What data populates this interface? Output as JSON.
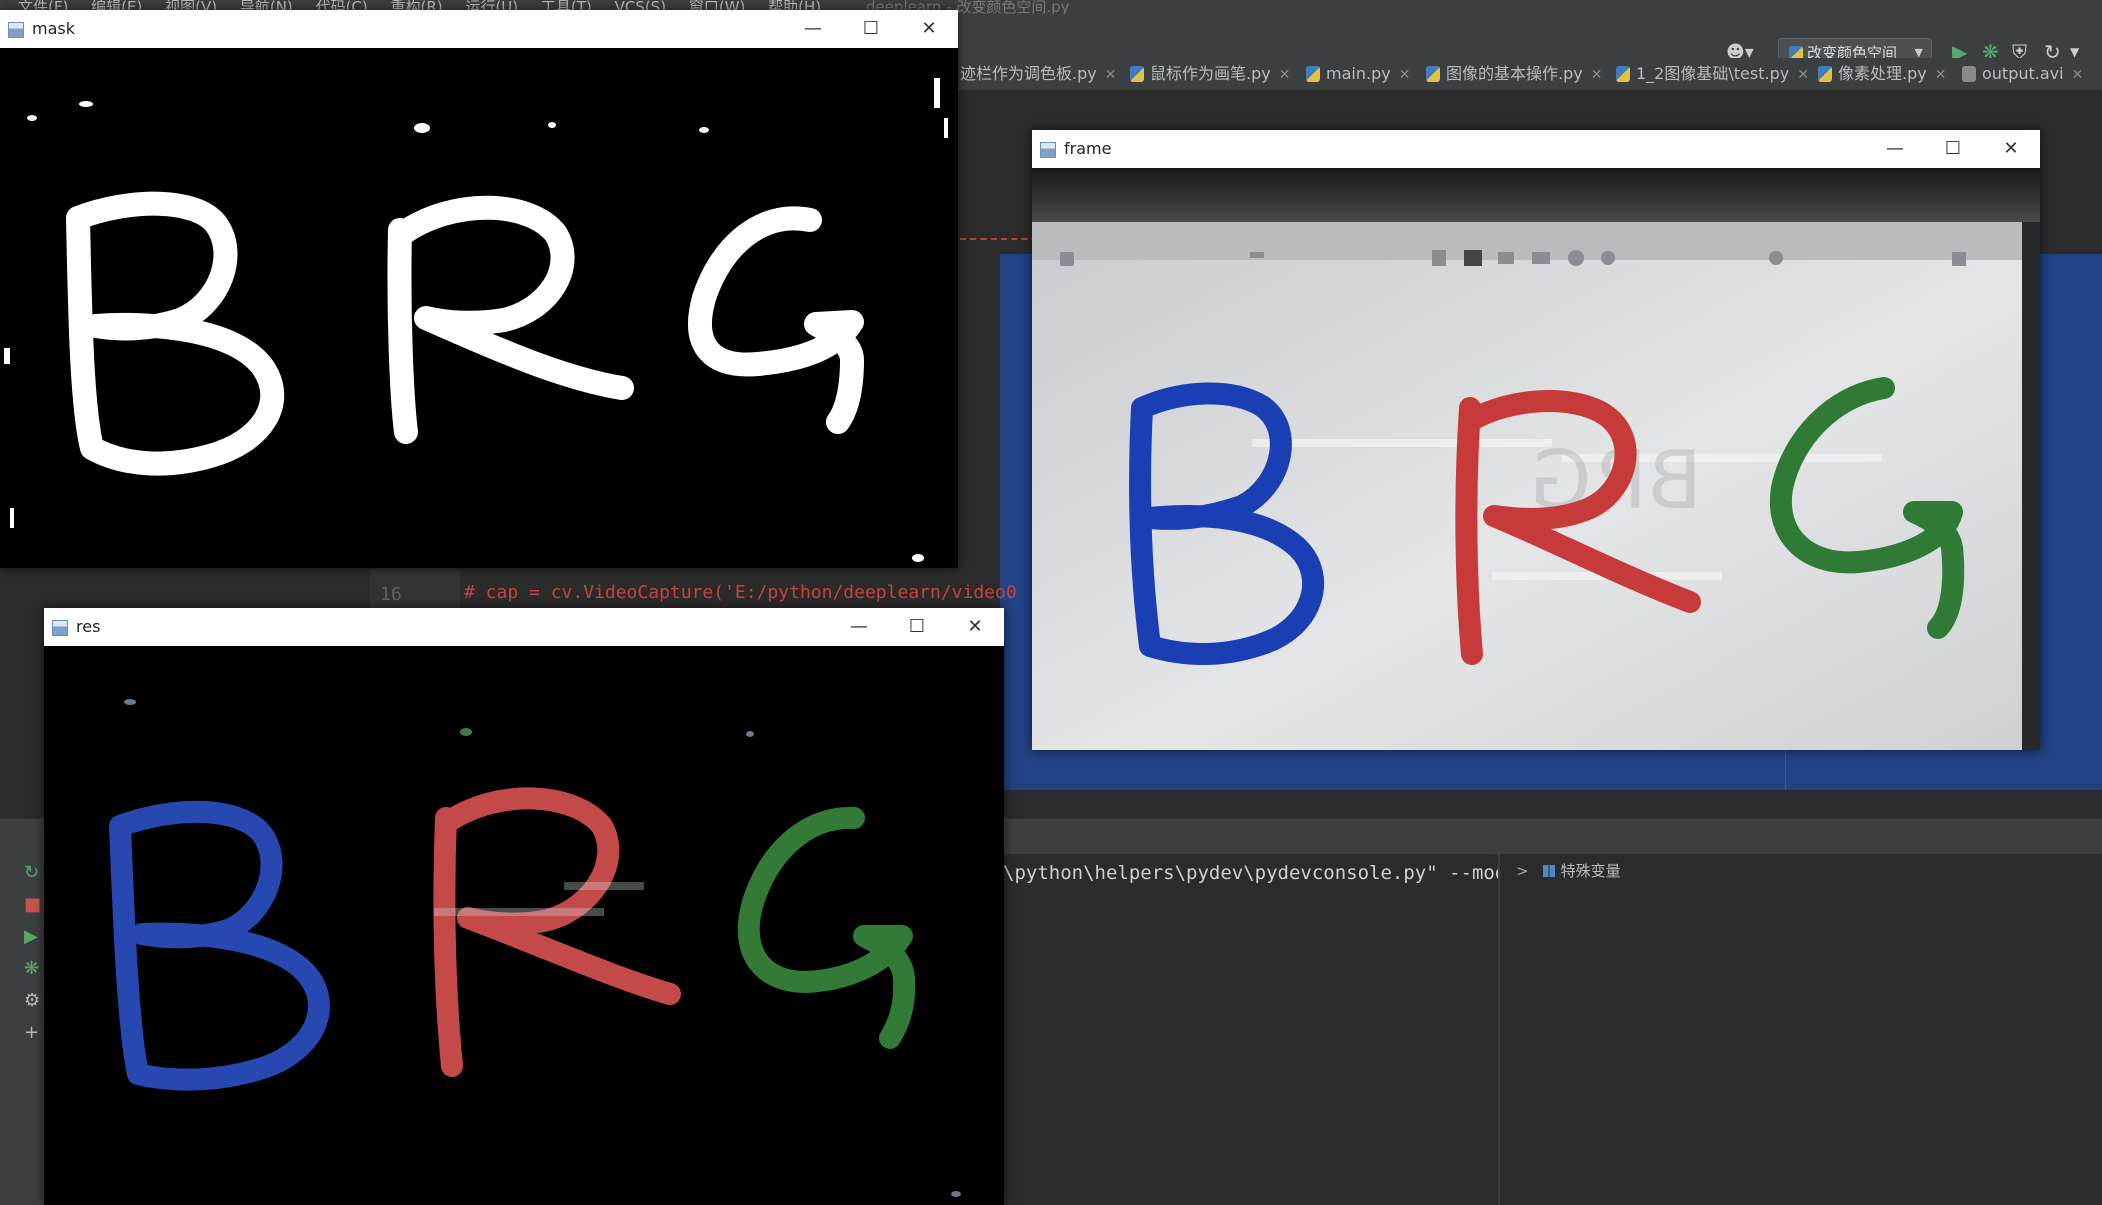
{
  "ide": {
    "menu": [
      "文件(F)",
      "编辑(E)",
      "视图(V)",
      "导航(N)",
      "代码(C)",
      "重构(R)",
      "运行(U)",
      "工具(T)",
      "VCS(S)",
      "窗口(W)",
      "帮助(H)"
    ],
    "project_title": "deeplearn - 改变颜色空间.py",
    "run_config": "改变颜色空间",
    "tabs": [
      {
        "label": "迹栏作为调色板.py",
        "icon": "python-file-icon"
      },
      {
        "label": "鼠标作为画笔.py",
        "icon": "python-file-icon"
      },
      {
        "label": "main.py",
        "icon": "python-file-icon"
      },
      {
        "label": "图像的基本操作.py",
        "icon": "python-file-icon"
      },
      {
        "label": "1_2图像基础\\test.py",
        "icon": "python-file-icon"
      },
      {
        "label": "像素处理.py",
        "icon": "python-file-icon"
      },
      {
        "label": "output.avi",
        "icon": "video-file-icon"
      }
    ],
    "line_number": "16",
    "code_line": "# cap = cv.VideoCapture('E:/python/deeplearn/video0",
    "console_text": "\\python\\helpers\\pydev\\pydevconsole.py\" --mode",
    "variables_label": "特殊变量",
    "colors": {
      "accent_blue": "#214283",
      "editor_bg": "#2b2b2b",
      "panel_bg": "#3c3f41"
    }
  },
  "windows": {
    "mask": {
      "title": "mask"
    },
    "res": {
      "title": "res"
    },
    "frame": {
      "title": "frame"
    }
  },
  "drawn_text": "BRG",
  "letter_colors": {
    "B": "#1a3fb5",
    "R": "#c73a3a",
    "G": "#2f7a35"
  }
}
